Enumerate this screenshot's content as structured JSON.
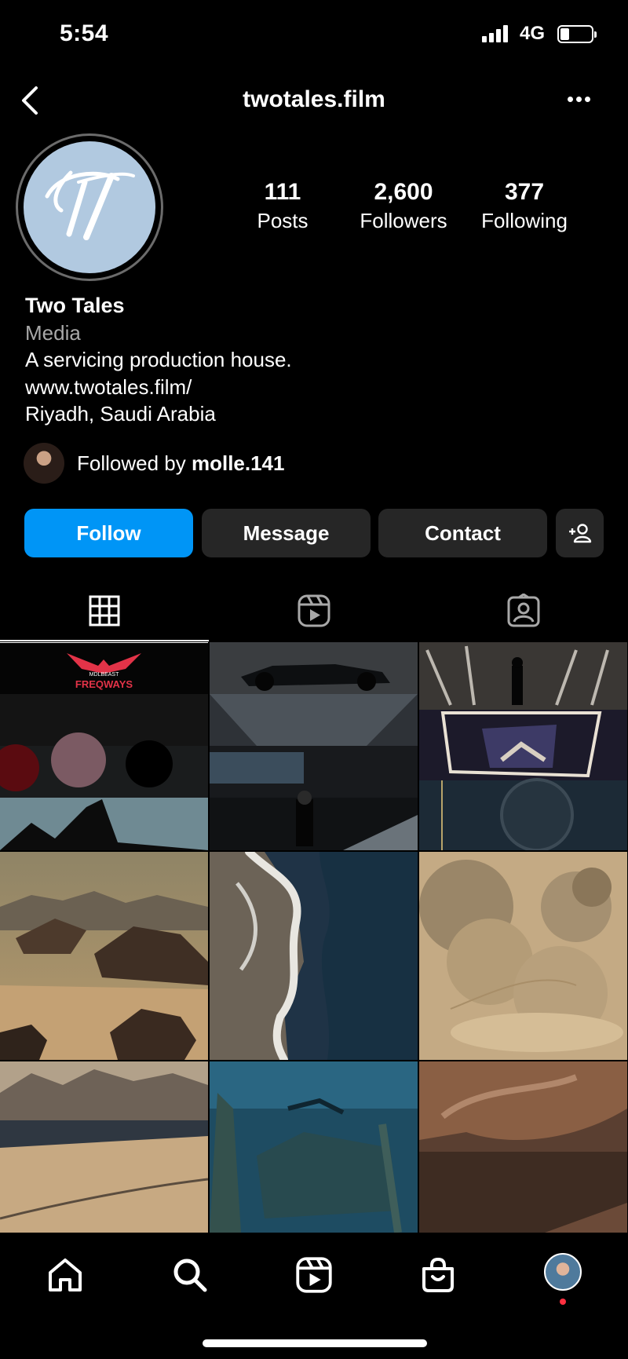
{
  "status_bar": {
    "time": "5:54",
    "network": "4G",
    "battery_level": 0.3
  },
  "header": {
    "username": "twotales.film",
    "back_icon": "chevron-left-icon",
    "more_icon": "ellipsis-icon"
  },
  "profile": {
    "avatar_logo": "TT",
    "stats": [
      {
        "value": "111",
        "label": "Posts"
      },
      {
        "value": "2,600",
        "label": "Followers"
      },
      {
        "value": "377",
        "label": "Following"
      }
    ],
    "name": "Two Tales",
    "category": "Media",
    "bio": "A servicing production house.",
    "website": "www.twotales.film/",
    "location": "Riyadh, Saudi Arabia",
    "followed_by_prefix": "Followed by ",
    "followed_by_user": "molle.141"
  },
  "actions": {
    "follow": "Follow",
    "message": "Message",
    "contact": "Contact",
    "suggest_icon": "add-person-icon"
  },
  "tabs": [
    {
      "name": "grid",
      "icon": "grid-icon",
      "active": true
    },
    {
      "name": "reels",
      "icon": "reels-icon",
      "active": false
    },
    {
      "name": "tagged",
      "icon": "tagged-person-icon",
      "active": false
    }
  ],
  "grid_posts": [
    {
      "title_line1": "MDLBEAST",
      "title_line2": "FREQWAYS",
      "accent": "#e23348"
    },
    {
      "subject": "race car"
    },
    {
      "subject": "stage lights"
    },
    {
      "subject": "desert canyon"
    },
    {
      "subject": "aerial shoreline"
    },
    {
      "subject": "dust trail"
    },
    {
      "subject": "mountain bay"
    },
    {
      "subject": "underwater wreck"
    },
    {
      "subject": "rock formation"
    }
  ],
  "bottom_nav": [
    {
      "name": "home",
      "icon": "home-icon"
    },
    {
      "name": "search",
      "icon": "search-icon"
    },
    {
      "name": "reels",
      "icon": "reels-icon"
    },
    {
      "name": "shop",
      "icon": "shopping-bag-icon"
    },
    {
      "name": "profile",
      "icon": "avatar"
    }
  ],
  "colors": {
    "primary_button": "#0095f6",
    "secondary_button": "#262626",
    "muted_text": "#a8a8a8",
    "notification_dot": "#ff3040"
  }
}
